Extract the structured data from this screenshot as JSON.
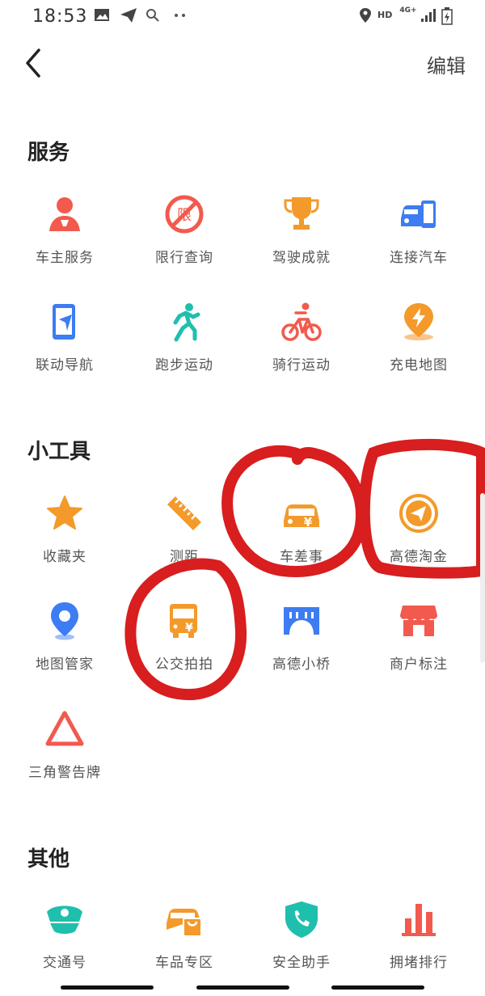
{
  "status_bar": {
    "time": "18:53",
    "hd": "HD",
    "network": "4G+",
    "icons": [
      "image-icon",
      "telegram-icon",
      "search-icon",
      "more-dots-icon",
      "location-icon",
      "signal-icon",
      "battery-icon"
    ]
  },
  "header": {
    "edit_label": "编辑"
  },
  "sections": {
    "services": {
      "title": "服务",
      "items": [
        {
          "label": "车主服务",
          "icon": "car-owner-icon",
          "color": "#f25a4d"
        },
        {
          "label": "限行查询",
          "icon": "no-entry-icon",
          "color": "#f25a4d"
        },
        {
          "label": "驾驶成就",
          "icon": "trophy-icon",
          "color": "#f39a2b"
        },
        {
          "label": "连接汽车",
          "icon": "car-phone-icon",
          "color": "#3d7cf2"
        },
        {
          "label": "联动导航",
          "icon": "phone-nav-icon",
          "color": "#3d7cf2"
        },
        {
          "label": "跑步运动",
          "icon": "runner-icon",
          "color": "#1fbfae"
        },
        {
          "label": "骑行运动",
          "icon": "cyclist-icon",
          "color": "#f25a4d"
        },
        {
          "label": "充电地图",
          "icon": "charging-pin-icon",
          "color": "#f39a2b"
        }
      ]
    },
    "tools": {
      "title": "小工具",
      "items": [
        {
          "label": "收藏夹",
          "icon": "star-icon",
          "color": "#f39a2b"
        },
        {
          "label": "测距",
          "icon": "ruler-icon",
          "color": "#f39a2b"
        },
        {
          "label": "车差事",
          "icon": "car-yuan-icon",
          "color": "#f39a2b"
        },
        {
          "label": "高德淘金",
          "icon": "paper-plane-coin-icon",
          "color": "#f39a2b"
        },
        {
          "label": "地图管家",
          "icon": "map-pin-icon",
          "color": "#3d7cf2"
        },
        {
          "label": "公交拍拍",
          "icon": "bus-yuan-icon",
          "color": "#f39a2b"
        },
        {
          "label": "高德小桥",
          "icon": "bridge-icon",
          "color": "#3d7cf2"
        },
        {
          "label": "商户标注",
          "icon": "shop-icon",
          "color": "#f25a4d"
        },
        {
          "label": "三角警告牌",
          "icon": "warning-triangle-icon",
          "color": "#f25a4d"
        }
      ]
    },
    "other": {
      "title": "其他",
      "items": [
        {
          "label": "交通号",
          "icon": "police-cap-icon",
          "color": "#1fbfae"
        },
        {
          "label": "车品专区",
          "icon": "car-shopping-icon",
          "color": "#f39a2b"
        },
        {
          "label": "安全助手",
          "icon": "shield-phone-icon",
          "color": "#1fbfae"
        },
        {
          "label": "拥堵排行",
          "icon": "bar-chart-icon",
          "color": "#f25a4d"
        }
      ]
    }
  },
  "annotation": {
    "color": "#d81e1e"
  }
}
